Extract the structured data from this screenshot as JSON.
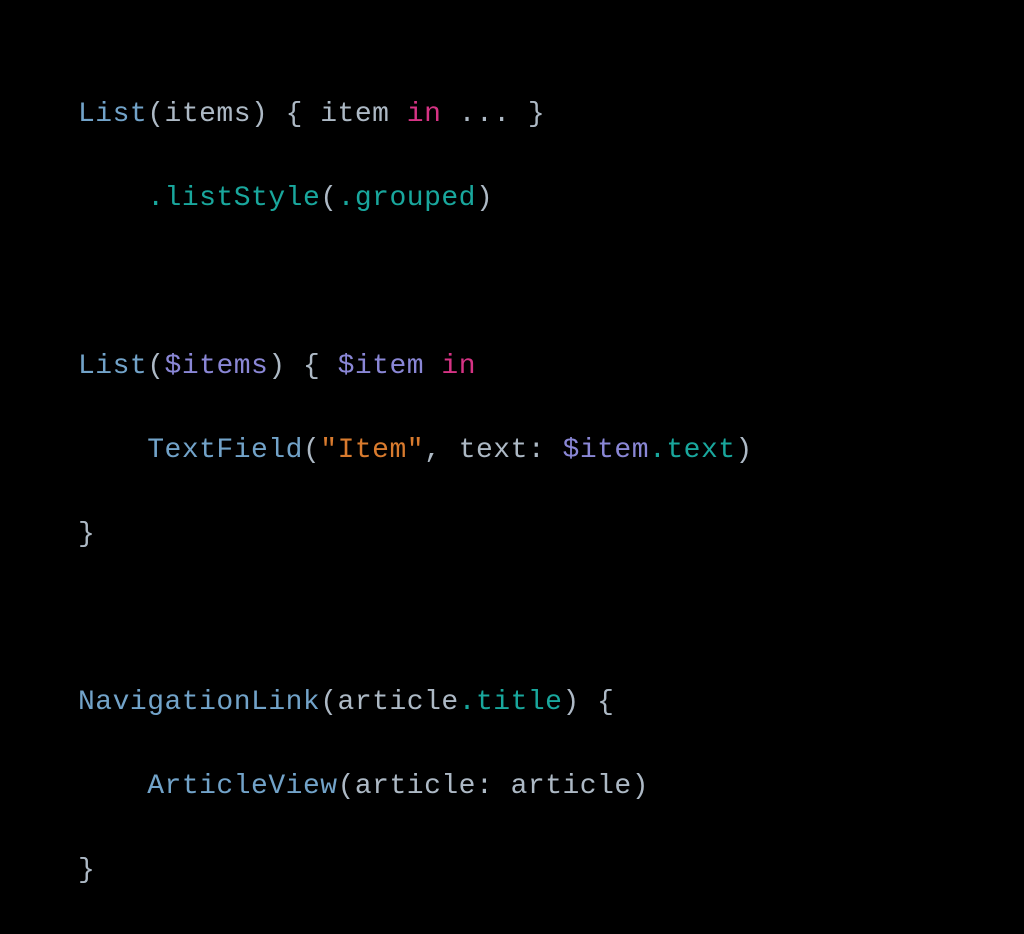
{
  "code": {
    "l1": {
      "a": "List",
      "b": "(items) { item ",
      "c": "in",
      "d": " ... }"
    },
    "l2": {
      "a": "    ",
      "b": ".listStyle",
      "c": "(",
      "d": ".grouped",
      "e": ")"
    },
    "l3": {
      "a": "List",
      "b": "(",
      "c": "$items",
      "d": ") { ",
      "e": "$item",
      "f": " ",
      "g": "in"
    },
    "l4": {
      "a": "    ",
      "b": "TextField",
      "c": "(",
      "d": "\"Item\"",
      "e": ", text: ",
      "f": "$item",
      "g": ".text",
      "h": ")"
    },
    "l5": {
      "a": "}"
    },
    "l6": {
      "a": "NavigationLink",
      "b": "(article",
      "c": ".title",
      "d": ") {"
    },
    "l7": {
      "a": "    ",
      "b": "ArticleView",
      "c": "(article: article)"
    },
    "l8": {
      "a": "}"
    }
  }
}
